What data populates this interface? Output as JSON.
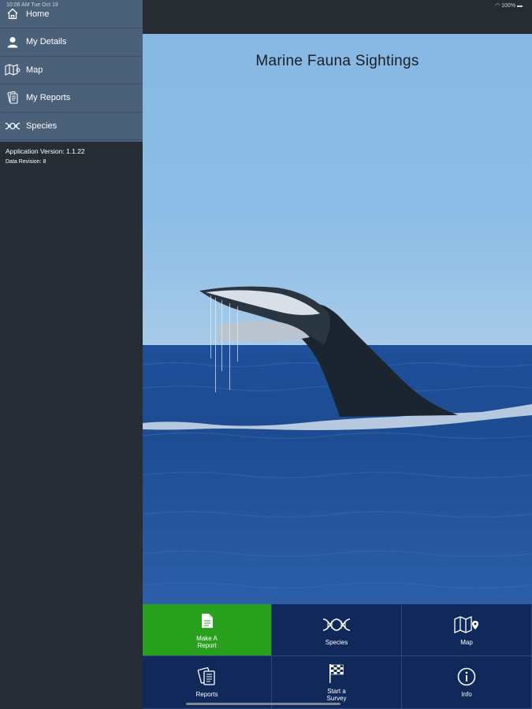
{
  "status_bar": {
    "time_date": "10:06 AM   Tue Oct 19",
    "battery": "100%"
  },
  "sidebar": {
    "items": [
      {
        "label": "Home",
        "icon": "home-icon"
      },
      {
        "label": "My Details",
        "icon": "person-icon"
      },
      {
        "label": "Map",
        "icon": "map-icon"
      },
      {
        "label": "My Reports",
        "icon": "reports-icon"
      },
      {
        "label": "Species",
        "icon": "dna-icon"
      }
    ],
    "app_version": "Application Version: 1.1.22",
    "data_revision": "Data Revision: 8"
  },
  "main": {
    "title": "Marine Fauna Sightings",
    "hero_image": "whale-tail-photo"
  },
  "tiles": [
    {
      "label_line1": "Make A",
      "label_line2": "Report",
      "icon": "document-icon",
      "active": true
    },
    {
      "label_line1": "Species",
      "label_line2": "",
      "icon": "dna-icon",
      "active": false
    },
    {
      "label_line1": "Map",
      "label_line2": "",
      "icon": "map-pin-icon",
      "active": false
    },
    {
      "label_line1": "Reports",
      "label_line2": "",
      "icon": "reports-stack-icon",
      "active": false
    },
    {
      "label_line1": "Start a",
      "label_line2": "Survey",
      "icon": "checkered-flag-icon",
      "active": false
    },
    {
      "label_line1": "Info",
      "label_line2": "",
      "icon": "info-icon",
      "active": false
    }
  ],
  "colors": {
    "sidebar_nav": "#4b6079",
    "sidebar_bg": "#262d34",
    "tile": "#11295a",
    "tile_active": "#2aa01f"
  }
}
